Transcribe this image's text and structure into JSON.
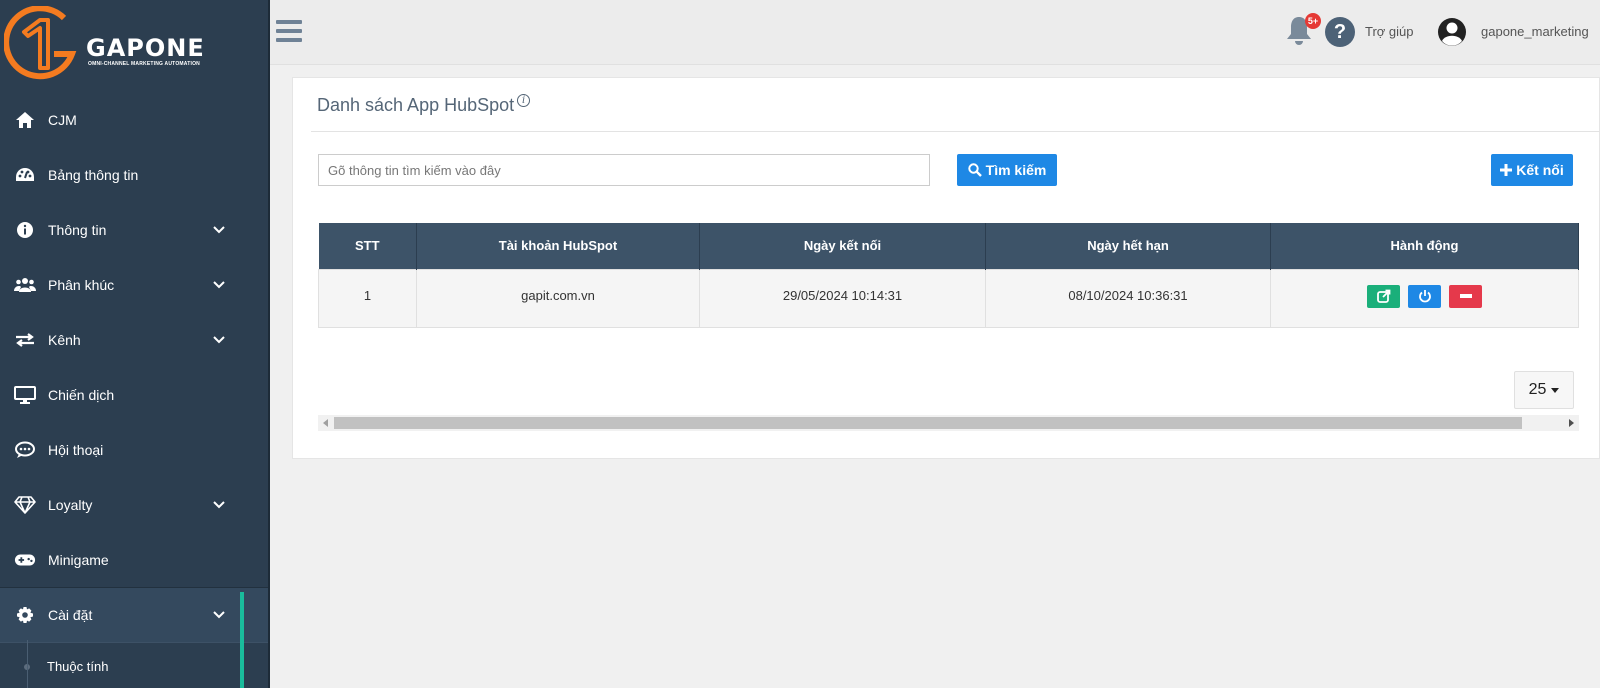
{
  "brand": {
    "name": "GAPONE",
    "tagline": "OMNI-CHANNEL MARKETING AUTOMATION",
    "accent_color": "#f47b20"
  },
  "sidebar": {
    "items": [
      {
        "label": "CJM",
        "icon": "home-icon",
        "has_chevron": false
      },
      {
        "label": "Bảng thông tin",
        "icon": "dashboard-icon",
        "has_chevron": false
      },
      {
        "label": "Thông tin",
        "icon": "info-icon",
        "has_chevron": true
      },
      {
        "label": "Phân khúc",
        "icon": "users-icon",
        "has_chevron": true
      },
      {
        "label": "Kênh",
        "icon": "exchange-icon",
        "has_chevron": true
      },
      {
        "label": "Chiến dịch",
        "icon": "desktop-icon",
        "has_chevron": false
      },
      {
        "label": "Hội thoại",
        "icon": "chat-icon",
        "has_chevron": false
      },
      {
        "label": "Loyalty",
        "icon": "diamond-icon",
        "has_chevron": true
      },
      {
        "label": "Minigame",
        "icon": "gamepad-icon",
        "has_chevron": false
      },
      {
        "label": "Cài đặt",
        "icon": "gear-icon",
        "has_chevron": true,
        "active": true
      }
    ],
    "sub_items": [
      {
        "label": "Thuộc tính"
      }
    ],
    "active_color": "#1abc9c"
  },
  "topbar": {
    "notifications_badge": "5+",
    "help_label": "Trợ giúp",
    "username": "gapone_marketing"
  },
  "page": {
    "title": "Danh sách App HubSpot",
    "search_placeholder": "Gõ thông tin tìm kiếm vào đây",
    "search_button": "Tìm kiếm",
    "connect_button": "Kết nối"
  },
  "table": {
    "columns": [
      "STT",
      "Tài khoản HubSpot",
      "Ngày kết nối",
      "Ngày hết hạn",
      "Hành động"
    ],
    "rows": [
      {
        "stt": "1",
        "account": "gapit.com.vn",
        "connected": "29/05/2024 10:14:31",
        "expires": "08/10/2024 10:36:31"
      }
    ],
    "action_colors": {
      "edit": "#1aaf7a",
      "power": "#1e88e5",
      "delete": "#e5394b"
    }
  },
  "pagination": {
    "page_size": "25"
  }
}
